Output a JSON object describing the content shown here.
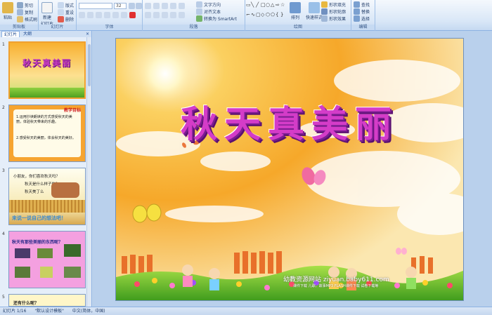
{
  "ribbon": {
    "clipboard": {
      "label": "剪贴板",
      "paste": "粘贴",
      "cut": "剪切",
      "copy": "复制",
      "format_painter": "格式刷"
    },
    "slides": {
      "label": "幻灯片",
      "new_slide": "新建\n幻灯片",
      "layout": "版式",
      "reset": "重设",
      "delete": "删除"
    },
    "font": {
      "label": "字体",
      "size": "32"
    },
    "paragraph": {
      "label": "段落",
      "text_direction": "文字方向",
      "align_text": "对齐文本",
      "convert_smartart": "转换为 SmartArt"
    },
    "drawing": {
      "label": "绘图",
      "arrange": "排列",
      "quick_styles": "快速样式",
      "shape_fill": "形状填充",
      "shape_outline": "形状轮廓",
      "shape_effects": "形状效果"
    },
    "editing": {
      "label": "编辑",
      "find": "查找",
      "replace": "替换",
      "select": "选择"
    }
  },
  "pane": {
    "tab_slides": "幻灯片",
    "tab_outline": "大纲",
    "close": "×",
    "thumbs": [
      {
        "num": "1",
        "title": "秋天真美丽"
      },
      {
        "num": "2",
        "title": "教学目标",
        "line1": "1.运用抄读朗读的方式感受秋天的美丽，体验秋天带来的乐趣。",
        "line2": "2.感受秋天的美丽，体会秋天的美好。"
      },
      {
        "num": "3",
        "q1": "小朋友，你们喜欢秋天吗？",
        "q2": "秋天是什么样子的？",
        "q3": "秋天美丁么",
        "bottom": "来说一说自己的想法吧！"
      },
      {
        "num": "4",
        "title": "秋天有那些美丽的东西呢？"
      },
      {
        "num": "5",
        "title": "还有什么呢？"
      }
    ]
  },
  "slide": {
    "title": "秋天真美丽",
    "watermark": "幼教资源网站  ziyuan.baby611.com",
    "watermark2": "课件下载  儿歌、故事MP3  FLASH课件下载  试卷下载等"
  },
  "status": {
    "slide": "幻灯片 1/16",
    "theme": "\"默认设计模板\"",
    "lang": "中文(简体，中国)"
  }
}
